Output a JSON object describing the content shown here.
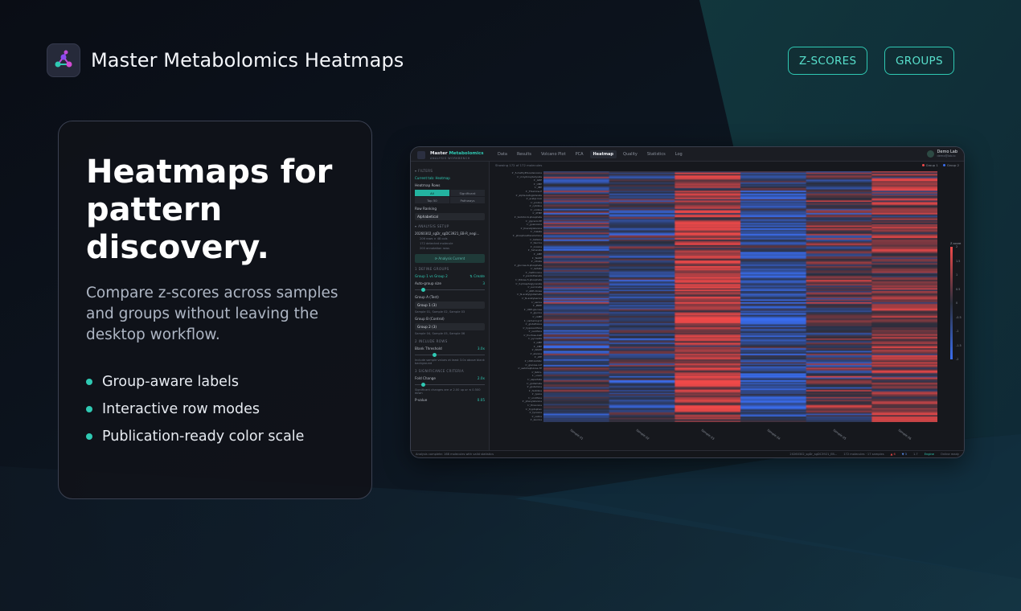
{
  "brand": {
    "title": "Master Metabolomics Heatmaps",
    "logo_icon": "molecule-icon"
  },
  "nav": {
    "zscores": "Z-SCORES",
    "groups": "GROUPS"
  },
  "hero": {
    "headline": "Heatmaps for pattern discovery.",
    "subtitle": "Compare z-scores across samples and groups without leaving the desktop workflow.",
    "bullets": [
      "Group-aware labels",
      "Interactive row modes",
      "Publication-ready color scale"
    ]
  },
  "colors": {
    "accent": "#2fc9b3",
    "high": "#f04a4a",
    "low": "#3b6ef0"
  },
  "app": {
    "name_a": "Master",
    "name_b": "Metabolomics",
    "subtitle": "ANALYSIS WORKBENCH",
    "tabs": [
      "Data",
      "Results",
      "Volcano Plot",
      "PCA",
      "Heatmap",
      "Quality",
      "Statistics",
      "Log"
    ],
    "active_tab": "Heatmap",
    "user": {
      "name": "Demo Lab",
      "email": "demo@lab.io"
    },
    "sidebar": {
      "filters": "▾ FILTERS",
      "link": "Current tab: Heatmap",
      "heatmap_rows": "Heatmap Rows",
      "row_modes": [
        "All",
        "Significant",
        "Top 50",
        "Pathways"
      ],
      "row_ranking": "Row Ranking",
      "ranking_value": "Alphabetical",
      "analysis_setup": "▾ ANALYSIS SETUP",
      "file": "20260302_sgDr_sgDC3921_EB-R_negi...",
      "file_meta": [
        "206 rows × 48 cols",
        "172 detected molecule",
        "200 annotation rows"
      ],
      "run_button": "⟳ Analysis Current",
      "define_groups": "1 DEFINE GROUPS",
      "group_vs": "Group 1 vs Group 2",
      "group_vs_action": "⇅ Create",
      "auto_group": "Auto-group size",
      "auto_group_value": "3",
      "group_a": "Group A (Test)",
      "group_a_value": "Group 1 (3)",
      "group_a_samples": "Sample 01, Sample 02, Sample 03",
      "group_b": "Group B (Control)",
      "group_b_value": "Group 2 (3)",
      "group_b_samples": "Sample 04, Sample 05, Sample 06",
      "include_rows": "2 INCLUDE ROWS",
      "blank_threshold": "Blank Threshold",
      "blank_value": "3.0x",
      "blank_hint": "Include sample values at least 3.0x above blank background",
      "significance": "3 SIGNIFICANCE CRITERIA",
      "fold_change": "Fold Change",
      "fold_value": "2.0x",
      "fold_hint": "Significant changes are ≥ 2.00 up or ≤ 0.500 down",
      "pvalue": "P-value",
      "pvalue_value": "0.05"
    },
    "showing": "Showing 172 of 172 molecules",
    "legend": [
      "Group 1",
      "Group 2"
    ],
    "samples": [
      "Sample 01",
      "Sample 02",
      "Sample 03",
      "Sample 04",
      "Sample 05",
      "Sample 06"
    ],
    "colorbar": {
      "title": "Z-score",
      "ticks": [
        "2",
        "1.5",
        "1",
        "0.5",
        "0",
        "-0.5",
        "-1",
        "-1.5",
        "-2"
      ]
    },
    "row_labels": [
      "1'_5-methylthioadenosine",
      "1'_2-hydroxybutyrate",
      "1'_GDP",
      "1'_UMP",
      "1'_IMP",
      "1'_Thiamine-P",
      "1'_alpha-ketoglutarate",
      "1'_acetyl-CoA",
      "1'_proline",
      "1'_cytidine",
      "1'_uridine",
      "1'_dTMP",
      "1'_Sorbitol-6-phosphate",
      "1'_glycerol-3P",
      "1'_guanosine",
      "1'_N-acetylalanine",
      "1'_malate",
      "1'_phosphoethanolamine",
      "1'_betaine",
      "1'_taurine",
      "1'_inosine",
      "1'_fumarate",
      "1'_AMP",
      "1'_NADP",
      "1'_citrate",
      "1'_glucose-6-phosphate",
      "1'_lactate",
      "1'_methionine",
      "1'_pantothenate",
      "1'_Ribose-5-phosphate",
      "1'_3-phosphoglycerate",
      "1'_succinate",
      "1'_ADP-ribose",
      "1'_N-acetylglutamate",
      "1'_N-acetylserine",
      "1'_serine",
      "1'_PRPP",
      "1'_UDP-glucose",
      "1'_glycine",
      "1'_cAMP",
      "1'_carbamoyl-P",
      "1'_glutathione",
      "1'_hypoxanthine",
      "1'_xanthine",
      "1'_fructose-bisP",
      "1'_pyruvate",
      "1'_GMP",
      "1'_CMP",
      "1'_NADH",
      "1'_alanine",
      "1'_ATP",
      "1'_UDP-GlcNAc",
      "1'_glucose-1-P",
      "1'_sedoheptulose-7P",
      "1'_NAD+",
      "1'_uracil",
      "1'_aspartate",
      "1'_glutamate",
      "1'_glutamine",
      "1'_histidine",
      "1'_lysine",
      "1'_ornithine",
      "1'_phenylalanine",
      "1'_threonine",
      "1'_tryptophan",
      "1'_tyrosine",
      "1'_valine",
      "1'_leucine"
    ],
    "status_left": "Analysis complete: 168 molecules with valid statistics",
    "status_file": "20260302_sgDr_sgDC3921_EB...",
    "status_counts": "172 molecules · 17 samples",
    "status_up": "▲ 6",
    "status_down": "▼ 3",
    "status_ratio": "1.7",
    "status_engine": "Engine",
    "status_update": "Online ready"
  }
}
